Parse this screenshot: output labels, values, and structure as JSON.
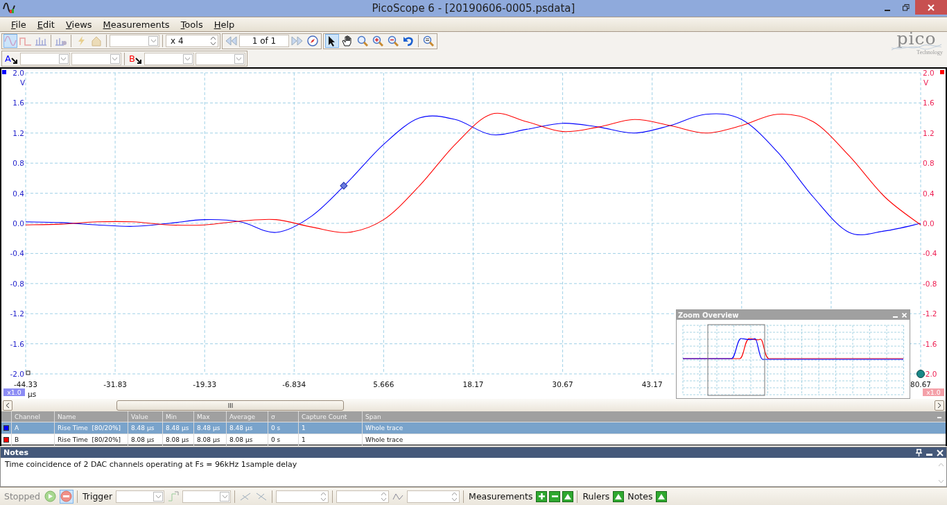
{
  "window": {
    "title": "PicoScope 6 - [20190606-0005.psdata]"
  },
  "menu": [
    "File",
    "Edit",
    "Views",
    "Measurements",
    "Tools",
    "Help"
  ],
  "toolbar": {
    "zoom_factor": "x 4",
    "buffer": "1 of 1",
    "tools": [
      {
        "kind": "pointer",
        "selected": true
      },
      {
        "kind": "hand",
        "selected": false
      },
      {
        "kind": "zoom",
        "selected": false
      },
      {
        "kind": "zoom-in",
        "selected": false
      },
      {
        "kind": "zoom-out",
        "selected": false
      },
      {
        "kind": "undo",
        "selected": false
      }
    ]
  },
  "channel_bar": [
    {
      "label": "A",
      "color": "#0000ff"
    },
    {
      "label": "B",
      "color": "#ff0000"
    }
  ],
  "logo": {
    "name": "pico",
    "tagline": "Technology"
  },
  "scope": {
    "left_scale": "x1.0",
    "right_scale": "x1.0",
    "overview": {
      "title": "Zoom Overview"
    },
    "chart_data": {
      "type": "line",
      "xlabel": "µs",
      "ylabel": "V",
      "x": [
        -44.33,
        -39.33,
        -34.33,
        -29.33,
        -24.33,
        -19.33,
        -14.33,
        -9.33,
        -4.33,
        0.67,
        5.67,
        10.67,
        15.67,
        20.67,
        25.67,
        30.67,
        35.67,
        40.67,
        45.67,
        50.67,
        55.67,
        60.67,
        65.67,
        70.67,
        75.67,
        80.67
      ],
      "series": [
        {
          "color": "#0000ff",
          "values": [
            0.02,
            0.01,
            -0.02,
            -0.04,
            0.0,
            0.05,
            0.02,
            -0.12,
            0.1,
            0.55,
            1.05,
            1.4,
            1.38,
            1.18,
            1.25,
            1.33,
            1.28,
            1.2,
            1.3,
            1.45,
            1.38,
            0.95,
            0.35,
            -0.12,
            -0.1,
            0.0
          ]
        },
        {
          "color": "#ff0000",
          "values": [
            -0.02,
            -0.01,
            0.02,
            0.02,
            -0.02,
            -0.02,
            0.03,
            0.05,
            -0.05,
            -0.12,
            0.05,
            0.5,
            1.05,
            1.45,
            1.35,
            1.22,
            1.28,
            1.38,
            1.3,
            1.2,
            1.3,
            1.45,
            1.35,
            0.9,
            0.35,
            -0.02
          ]
        }
      ],
      "grid": true,
      "xlim": [
        -44.33,
        80.67
      ],
      "ylim": [
        -2.0,
        2.0
      ],
      "xticks": [
        {
          "value": -44.33,
          "label": "-44.33"
        },
        {
          "value": -31.83,
          "label": "-31.83"
        },
        {
          "value": -19.33,
          "label": "-19.33"
        },
        {
          "value": -6.834,
          "label": "-6.834"
        },
        {
          "value": 5.666,
          "label": "5.666"
        },
        {
          "value": 18.17,
          "label": "18.17"
        },
        {
          "value": 30.67,
          "label": "30.67"
        },
        {
          "value": 43.17,
          "label": "43.17"
        },
        {
          "value": 80.67,
          "label": "80.67"
        }
      ],
      "yticks": [
        {
          "value": 2.0,
          "label": "2.0"
        },
        {
          "value": 1.6,
          "label": "1.6"
        },
        {
          "value": 1.2,
          "label": "1.2"
        },
        {
          "value": 0.8,
          "label": "0.8"
        },
        {
          "value": 0.4,
          "label": "0.4"
        },
        {
          "value": 0.0,
          "label": "0.0"
        },
        {
          "value": -0.4,
          "label": "-0.4"
        },
        {
          "value": -0.8,
          "label": "-0.8"
        },
        {
          "value": -1.2,
          "label": "-1.2"
        },
        {
          "value": -1.6,
          "label": "-1.6"
        },
        {
          "value": -2.0,
          "label": "-2.0"
        }
      ]
    }
  },
  "measurements": {
    "columns": [
      "Channel",
      "Name",
      "Value",
      "Min",
      "Max",
      "Average",
      "σ",
      "Capture Count",
      "Span"
    ],
    "rows": [
      {
        "color": "#0000ff",
        "selected": true,
        "cells": [
          "A",
          "Rise Time  [80/20%]",
          "8.48 µs",
          "8.48 µs",
          "8.48 µs",
          "8.48 µs",
          "0 s",
          "1",
          "Whole trace"
        ]
      },
      {
        "color": "#ff0000",
        "selected": false,
        "cells": [
          "B",
          "Rise Time  [80/20%]",
          "8.08 µs",
          "8.08 µs",
          "8.08 µs",
          "8.08 µs",
          "0 s",
          "1",
          "Whole trace"
        ]
      }
    ]
  },
  "notes": {
    "title": "Notes",
    "text": "Time coincidence of 2 DAC channels operating at Fs = 96kHz 1sample delay"
  },
  "status_bar": {
    "state": "Stopped",
    "trigger": "Trigger",
    "measurements": "Measurements",
    "rulers": "Rulers",
    "notes": "Notes"
  }
}
